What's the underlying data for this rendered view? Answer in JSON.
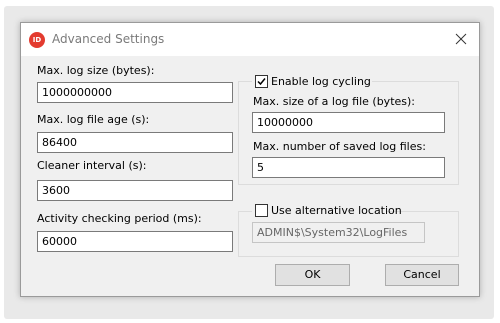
{
  "window": {
    "title": "Advanced Settings",
    "icon_label": "ID",
    "icon": "close-icon"
  },
  "left": {
    "max_log_size": {
      "label": "Max. log size (bytes):",
      "value": "1000000000"
    },
    "max_log_file_age": {
      "label": "Max. log file age (s):",
      "value": "86400"
    },
    "cleaner_interval": {
      "label": "Cleaner interval (s):",
      "value": "3600"
    },
    "activity_period": {
      "label": "Activity checking period (ms):",
      "value": "60000"
    }
  },
  "log_cycling": {
    "checkbox_label": "Enable log cycling",
    "checked": true,
    "max_file_size": {
      "label": "Max. size of a log file (bytes):",
      "value": "10000000"
    },
    "max_saved_files": {
      "label": "Max. number of saved log files:",
      "value": "5"
    }
  },
  "alt_location": {
    "checkbox_label": "Use alternative location",
    "checked": false,
    "path": "ADMIN$\\System32\\LogFiles"
  },
  "buttons": {
    "ok": "OK",
    "cancel": "Cancel"
  }
}
